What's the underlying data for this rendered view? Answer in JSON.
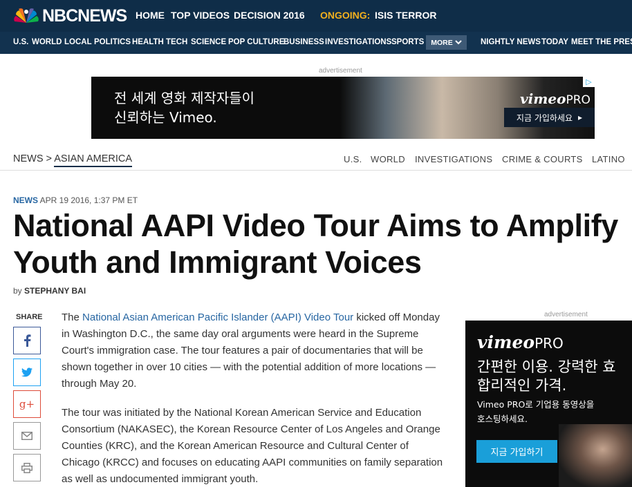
{
  "header": {
    "logo_text": "NBCNEWS",
    "links": [
      "HOME",
      "TOP VIDEOS",
      "DECISION 2016"
    ],
    "ongoing_label": "ONGOING:",
    "ongoing_topic": "ISIS TERROR"
  },
  "nav": {
    "items": [
      "U.S.",
      "WORLD",
      "LOCAL",
      "POLITICS",
      "HEALTH",
      "TECH",
      "SCIENCE",
      "POP CULTURE",
      "BUSINESS",
      "INVESTIGATIONS",
      "SPORTS"
    ],
    "more_label": "MORE",
    "right_items": [
      "NIGHTLY NEWS",
      "TODAY",
      "MEET THE PRESS"
    ]
  },
  "ad_top": {
    "label": "advertisement",
    "line1": "전 세계 영화 제작자들이",
    "line2": "신뢰하는 Vimeo.",
    "logo": "vimeo",
    "logo_suffix": "PRO",
    "cta": "지금 가입하세요",
    "cta_arrow": "▸",
    "choices_icon": "▷"
  },
  "section": {
    "parent": "NEWS",
    "separator": ">",
    "current": "ASIAN AMERICA",
    "subnav": [
      "U.S.",
      "WORLD",
      "INVESTIGATIONS",
      "CRIME & COURTS",
      "LATINO"
    ]
  },
  "article": {
    "category": "NEWS",
    "timestamp": "APR 19 2016, 1:37 PM ET",
    "headline": "National AAPI Video Tour Aims to Amplify Youth and Immigrant Voices",
    "byline_prefix": "by",
    "author": "STEPHANY BAI",
    "p1_before": "The ",
    "p1_link": "National Asian American Pacific Islander (AAPI) Video Tour",
    "p1_after": " kicked off Monday in Washington D.C., the same day oral arguments were heard in the Supreme Court's immigration case. The tour features a pair of documentaries that will be shown together in over 10 cities — with the potential addition of more locations — through May 20.",
    "p2": "The tour was initiated by the National Korean American Service and Education Consortium (NAKASEC), the Korean Resource Center of Los Angeles and Orange Counties (KRC), and the Korean American Resource and Cultural Center of Chicago (KRCC) and focuses on educating AAPI communities on family separation as well as undocumented immigrant youth."
  },
  "share": {
    "label": "SHARE",
    "buttons": [
      {
        "name": "facebook",
        "glyph": "f",
        "color": "#3b5998"
      },
      {
        "name": "twitter",
        "glyph": "🐦",
        "color": "#1da1f2"
      },
      {
        "name": "google-plus",
        "glyph": "g+",
        "color": "#dd4b39"
      },
      {
        "name": "email",
        "glyph": "✉",
        "color": "#888888"
      },
      {
        "name": "print",
        "glyph": "⎙",
        "color": "#888888"
      }
    ]
  },
  "ad_side": {
    "label": "advertisement",
    "logo": "vimeo",
    "logo_suffix": "PRO",
    "headline_line1": "간편한 이용. 강력한 효",
    "headline_line2": "합리적인 가격.",
    "sub_line1": "Vimeo PRO로 기업용 동영상을",
    "sub_line2": "호스팅하세요.",
    "cta": "지금 가입하기"
  },
  "colors": {
    "topbar": "#0f2d48",
    "ongoing": "#f2b01e",
    "link": "#2766a2"
  }
}
